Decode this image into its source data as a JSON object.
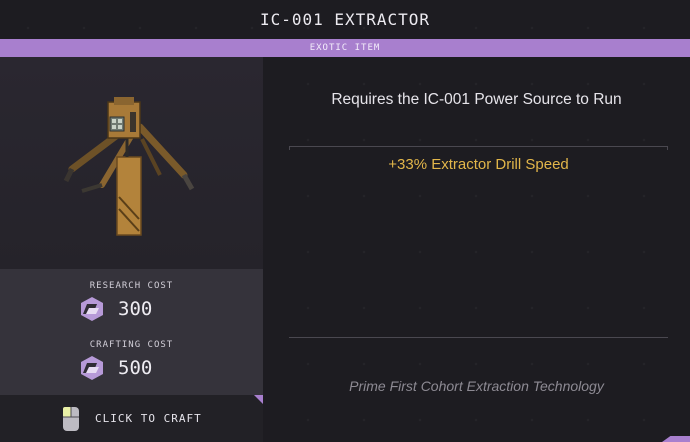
{
  "title": "IC-001 EXTRACTOR",
  "rarity": "EXOTIC ITEM",
  "requirement": "Requires the IC-001 Power Source to Run",
  "effects": [
    "+33% Extractor Drill Speed"
  ],
  "costs": {
    "research_label": "RESEARCH COST",
    "research_value": "300",
    "crafting_label": "CRAFTING COST",
    "crafting_value": "500",
    "currency_icon": "hex-crystal-icon"
  },
  "craft_action": {
    "label": "CLICK TO CRAFT",
    "icon": "mouse-left-click-icon"
  },
  "flavor_text": "Prime First Cohort Extraction Technology",
  "colors": {
    "accent": "#a87fce",
    "effect": "#e2b64a",
    "background": "#1d1c21"
  }
}
